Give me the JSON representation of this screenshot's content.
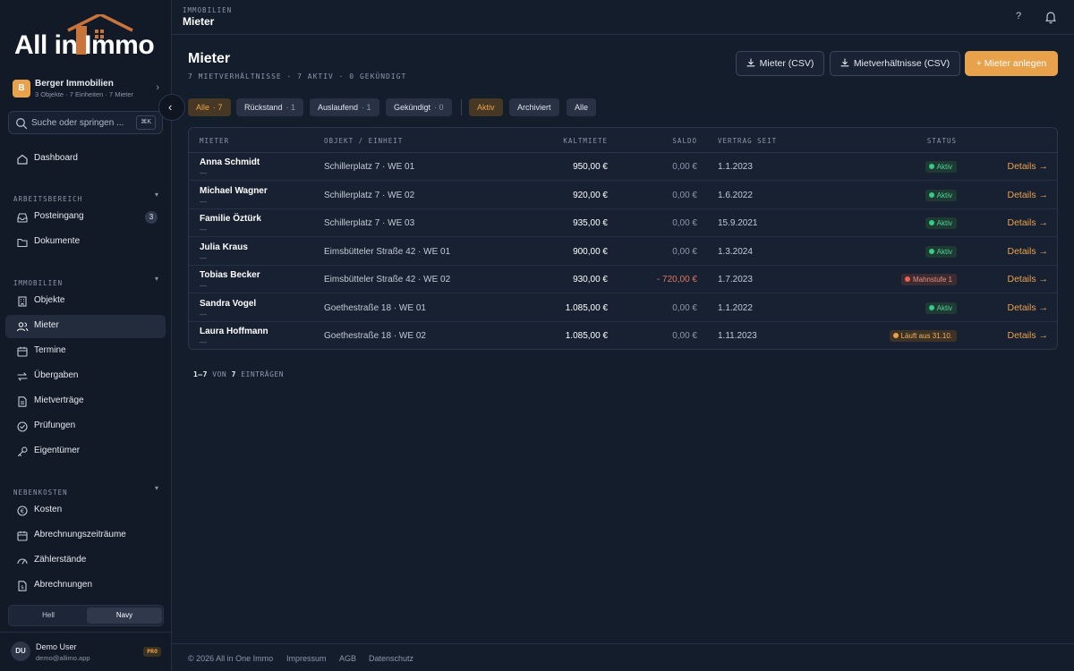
{
  "brand": {
    "logo_text": "All in Immo",
    "accent": "#e9a24c"
  },
  "tenant": {
    "initial": "B",
    "name": "Berger Immobilien",
    "meta": "3 Objekte · 7 Einheiten · 7 Mieter"
  },
  "search": {
    "placeholder": "Suche oder springen ...",
    "shortcut": "⌘K"
  },
  "nav": {
    "dashboard": "Dashboard",
    "workspace_label": "ARBEITSBEREICH",
    "inbox": "Posteingang",
    "inbox_count": "3",
    "documents": "Dokumente",
    "realestate_label": "IMMOBILIEN",
    "objects": "Objekte",
    "tenants": "Mieter",
    "appointments": "Termine",
    "handovers": "Übergaben",
    "leases": "Mietverträge",
    "inspections": "Prüfungen",
    "owners": "Eigentümer",
    "costs_label": "NEBENKOSTEN",
    "costs": "Kosten",
    "periods": "Abrechnungszeiträume",
    "meters": "Zählerstände",
    "statements": "Abrechnungen"
  },
  "theme": {
    "light": "Hell",
    "navy": "Navy"
  },
  "user": {
    "initials": "DU",
    "name": "Demo User",
    "email": "demo@allimo.app",
    "plan": "PRO"
  },
  "topbar": {
    "section": "IMMOBILIEN",
    "title": "Mieter",
    "help": "?"
  },
  "page": {
    "title": "Mieter",
    "subtitle": "7 MIETVERHÄLTNISSE · 7 AKTIV · 0 GEKÜNDIGT",
    "export_tenants": "Mieter (CSV)",
    "export_leases": "Mietverhältnisse (CSV)",
    "add_tenant": "+ Mieter anlegen"
  },
  "filters": {
    "all": {
      "label": "Alle",
      "count": "· 7"
    },
    "arrears": {
      "label": "Rückstand",
      "count": "· 1"
    },
    "expiring": {
      "label": "Auslaufend",
      "count": "· 1"
    },
    "terminated": {
      "label": "Gekündigt",
      "count": "· 0"
    },
    "state_active": "Aktiv",
    "state_archived": "Archiviert",
    "state_all": "Alle"
  },
  "table": {
    "headers": {
      "tenant": "MIETER",
      "object": "OBJEKT / EINHEIT",
      "rent": "KALTMIETE",
      "saldo": "SALDO",
      "since": "VERTRAG SEIT",
      "status": "STATUS"
    },
    "details_label": "Details →",
    "rows": [
      {
        "name": "Anna Schmidt",
        "sub": "—",
        "object": "Schillerplatz 7 · WE 01",
        "rent": "950,00 €",
        "saldo": "0,00 €",
        "since": "1.1.2023",
        "status": "Aktiv"
      },
      {
        "name": "Michael Wagner",
        "sub": "—",
        "object": "Schillerplatz 7 · WE 02",
        "rent": "920,00 €",
        "saldo": "0,00 €",
        "since": "1.6.2022",
        "status": "Aktiv"
      },
      {
        "name": "Familie Öztürk",
        "sub": "—",
        "object": "Schillerplatz 7 · WE 03",
        "rent": "935,00 €",
        "saldo": "0,00 €",
        "since": "15.9.2021",
        "status": "Aktiv"
      },
      {
        "name": "Julia Kraus",
        "sub": "—",
        "object": "Eimsbütteler Straße 42 · WE 01",
        "rent": "900,00 €",
        "saldo": "0,00 €",
        "since": "1.3.2024",
        "status": "Aktiv"
      },
      {
        "name": "Tobias Becker",
        "sub": "—",
        "object": "Eimsbütteler Straße 42 · WE 02",
        "rent": "930,00 €",
        "saldo": "- 720,00 €",
        "since": "1.7.2023",
        "status": "Mahnstufe 1"
      },
      {
        "name": "Sandra Vogel",
        "sub": "—",
        "object": "Goethestraße 18 · WE 01",
        "rent": "1.085,00 €",
        "saldo": "0,00 €",
        "since": "1.1.2022",
        "status": "Aktiv"
      },
      {
        "name": "Laura Hoffmann",
        "sub": "—",
        "object": "Goethestraße 18 · WE 02",
        "rent": "1.085,00 €",
        "saldo": "0,00 €",
        "since": "1.11.2023",
        "status": "Läuft aus 31.10."
      }
    ]
  },
  "pager": {
    "range": "1–7",
    "of": "VON",
    "total": "7",
    "suffix": "EINTRÄGEN"
  },
  "footer": {
    "copyright": "© 2026 All in One Immo",
    "imprint": "Impressum",
    "terms": "AGB",
    "privacy": "Datenschutz"
  }
}
